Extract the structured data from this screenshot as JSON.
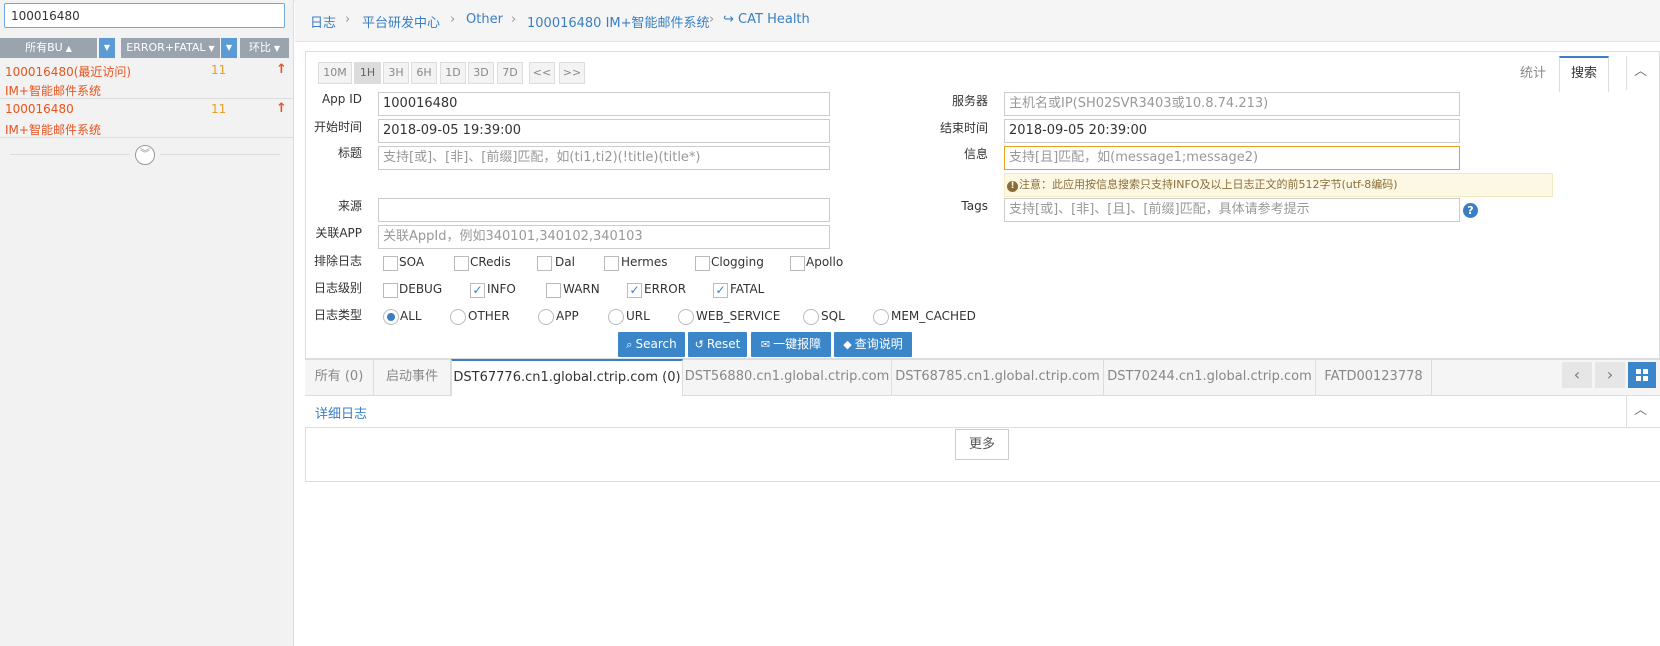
{
  "sidebar": {
    "search_value": "100016480",
    "filters": {
      "bu": "所有BU",
      "level": "ERROR+FATAL",
      "compare": "环比"
    },
    "items": [
      {
        "title": "100016480(最近访问)",
        "subtitle": "IM+智能邮件系统",
        "count": "11"
      },
      {
        "title": "100016480",
        "subtitle": "IM+智能邮件系统",
        "count": "11"
      }
    ]
  },
  "breadcrumb": {
    "items": [
      "日志",
      "平台研发中心",
      "Other",
      "100016480 IM+智能邮件系统"
    ],
    "health": "CAT Health"
  },
  "time_ranges": [
    "10M",
    "1H",
    "3H",
    "6H",
    "1D",
    "3D",
    "7D",
    "<<",
    ">>"
  ],
  "panel_tabs": {
    "stats": "统计",
    "search": "搜索"
  },
  "form": {
    "appid_label": "App ID",
    "appid_value": "100016480",
    "server_label": "服务器",
    "server_placeholder": "主机名或IP(SH02SVR3403或10.8.74.213)",
    "start_label": "开始时间",
    "start_value": "2018-09-05 19:39:00",
    "end_label": "结束时间",
    "end_value": "2018-09-05 20:39:00",
    "title_label": "标题",
    "title_placeholder": "支持[或]、[非]、[前缀]匹配，如(ti1,ti2)(!title)(title*)",
    "message_label": "信息",
    "message_placeholder": "支持[且]匹配，如(message1;message2)",
    "notice": "注意：此应用按信息搜索只支持INFO及以上日志正文的前512字节(utf-8编码)",
    "source_label": "来源",
    "tags_label": "Tags",
    "tags_placeholder": "支持[或]、[非]、[且]、[前缀]匹配，具体请参考提示",
    "related_label": "关联APP",
    "related_placeholder": "关联AppId，例如340101,340102,340103",
    "exclude_label": "排除日志",
    "exclude_options": [
      "SOA",
      "CRedis",
      "Dal",
      "Hermes",
      "Clogging",
      "Apollo"
    ],
    "level_label": "日志级别",
    "level_options": [
      "DEBUG",
      "INFO",
      "WARN",
      "ERROR",
      "FATAL"
    ],
    "type_label": "日志类型",
    "type_options": [
      "ALL",
      "OTHER",
      "APP",
      "URL",
      "WEB_SERVICE",
      "SQL",
      "MEM_CACHED"
    ]
  },
  "buttons": {
    "search": "Search",
    "reset": "Reset",
    "report": "一键报障",
    "help": "查询说明"
  },
  "host_tabs": [
    "所有 (0)",
    "启动事件",
    "DST67776.cn1.global.ctrip.com (0)",
    "DST56880.cn1.global.ctrip.com",
    "DST68785.cn1.global.ctrip.com",
    "DST70244.cn1.global.ctrip.com",
    "FATD00123778"
  ],
  "detail": {
    "title": "详细日志",
    "more": "更多"
  },
  "colors": {
    "accent": "#3a7fc4",
    "alert": "#e8541e",
    "count": "#e8a020"
  }
}
